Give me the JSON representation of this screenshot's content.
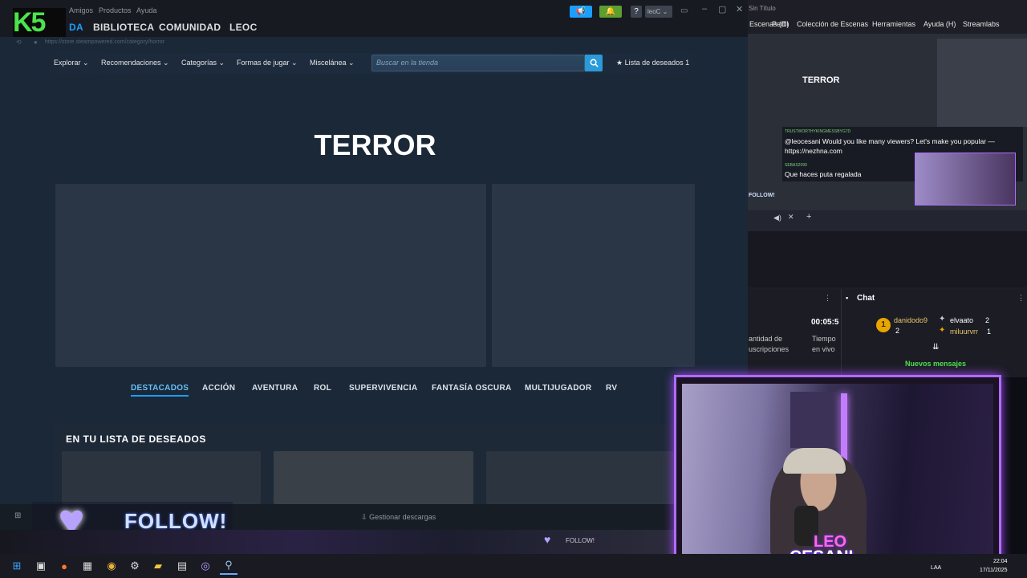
{
  "steam": {
    "logo": "K5",
    "topmenu": [
      "Amigos",
      "Productos",
      "Ayuda"
    ],
    "mainnav": {
      "tienda": "DA",
      "biblioteca": "BIBLIOTECA",
      "comunidad": "COMUNIDAD",
      "user": "LEOC"
    },
    "url": "https://store.steampowered.com/category/horror",
    "account": "leoC",
    "store_nav": [
      "Explorar",
      "Recomendaciones",
      "Categorías",
      "Formas de jugar",
      "Miscelánea"
    ],
    "search_placeholder": "Buscar en la tienda",
    "wishlist_label": "Lista de deseados",
    "wishlist_count": "1",
    "page_title": "TERROR",
    "tabs": [
      "DESTACADOS",
      "ACCIÓN",
      "AVENTURA",
      "ROL",
      "SUPERVIVENCIA",
      "FANTASÍA OSCURA",
      "MULTIJUGADOR",
      "RV"
    ],
    "wishlist_section_title": "EN TU LISTA DE DESEADOS",
    "downloads_label": "Gestionar descargas"
  },
  "overlay": {
    "follow_label": "FOLLOW!",
    "strip_follow": "FOLLOW!"
  },
  "obs": {
    "title": "Sin Título",
    "menu": [
      "Escenas (D)",
      "Perfil",
      "Colección de Escenas",
      "Herramientas",
      "Ayuda (H)",
      "Streamlabs"
    ],
    "preview_title": "TERROR",
    "chat_user1": "TRUSTWORTHYKINGMESSBYG7D",
    "chat_msg1": "@leocesani Would you like many viewers? Let's make you popular — https://nezhna.com",
    "chat_user2": "SEBAS2099",
    "chat_msg2": "Que haces puta regalada",
    "follow_preview": "FOLLOW!",
    "timer": "00:05:5",
    "stat_label1": "antidad de",
    "stat_label1b": "uscripciones",
    "stat_label2": "Tiempo",
    "stat_label2b": "en vivo",
    "chat_title": "Chat",
    "top_users": [
      {
        "name": "danidodo9",
        "count": "2"
      },
      {
        "name": "elvaato",
        "count": "2"
      },
      {
        "name": "miluurvrr",
        "count": "1"
      }
    ],
    "badge_number": "1",
    "new_messages": "Nuevos mensajes"
  },
  "webcam": {
    "name_line1": "LEO",
    "name_line2": "CESANI"
  },
  "taskbar": {
    "lang": "LAA",
    "time": "22:04",
    "date": "17/11/2025"
  }
}
